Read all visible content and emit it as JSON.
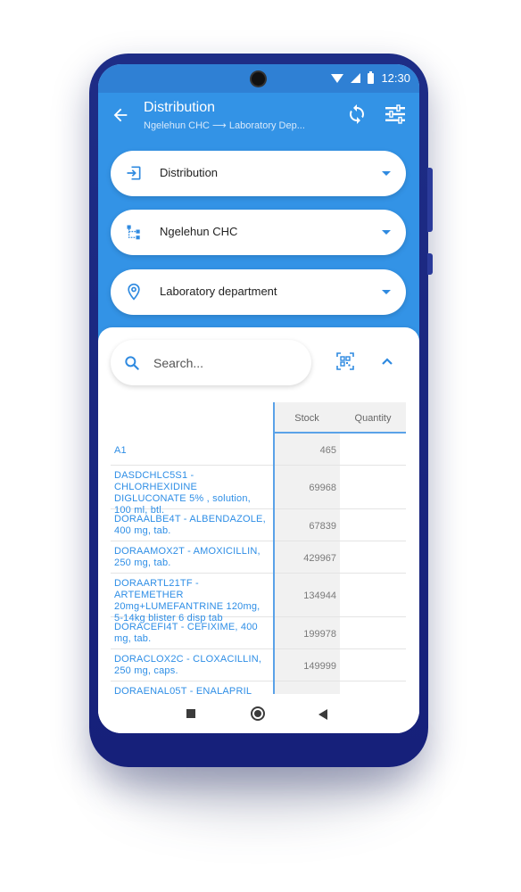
{
  "status_bar": {
    "time": "12:30"
  },
  "header": {
    "title": "Distribution",
    "subtitle_from": "Ngelehun CHC",
    "subtitle_arrow": "⟶",
    "subtitle_to": "Laboratory Dep..."
  },
  "dropdowns": [
    {
      "label": "Distribution",
      "icon": "transaction-type-icon"
    },
    {
      "label": "Ngelehun CHC",
      "icon": "org-unit-icon"
    },
    {
      "label": "Laboratory department",
      "icon": "location-pin-icon"
    }
  ],
  "search": {
    "placeholder": "Search..."
  },
  "table": {
    "columns": {
      "stock": "Stock",
      "quantity": "Quantity"
    },
    "rows": [
      {
        "name": "A1",
        "stock": "465"
      },
      {
        "name": "DASDCHLC5S1 - CHLORHEXIDINE DIGLUCONATE 5% , solution, 100 ml, btl.",
        "stock": "69968"
      },
      {
        "name": "DORAALBE4T - ALBENDAZOLE, 400 mg, tab.",
        "stock": "67839"
      },
      {
        "name": "DORAAMOX2T - AMOXICILLIN, 250 mg, tab.",
        "stock": "429967"
      },
      {
        "name": "DORAARTL21TF - ARTEMETHER 20mg+LUMEFANTRINE 120mg, 5-14kg blister 6 disp tab",
        "stock": "134944"
      },
      {
        "name": "DORACEFI4T - CEFIXIME, 400 mg, tab.",
        "stock": "199978"
      },
      {
        "name": "DORACLOX2C - CLOXACILLIN, 250 mg, caps.",
        "stock": "149999"
      },
      {
        "name": "DORAENAL05T - ENALAPRIL",
        "stock": ""
      }
    ]
  },
  "colors": {
    "primary": "#3393e6",
    "status_bar": "#2f80d4",
    "link_text": "#2e8ee6",
    "phone_frame": "#1e2d86"
  }
}
